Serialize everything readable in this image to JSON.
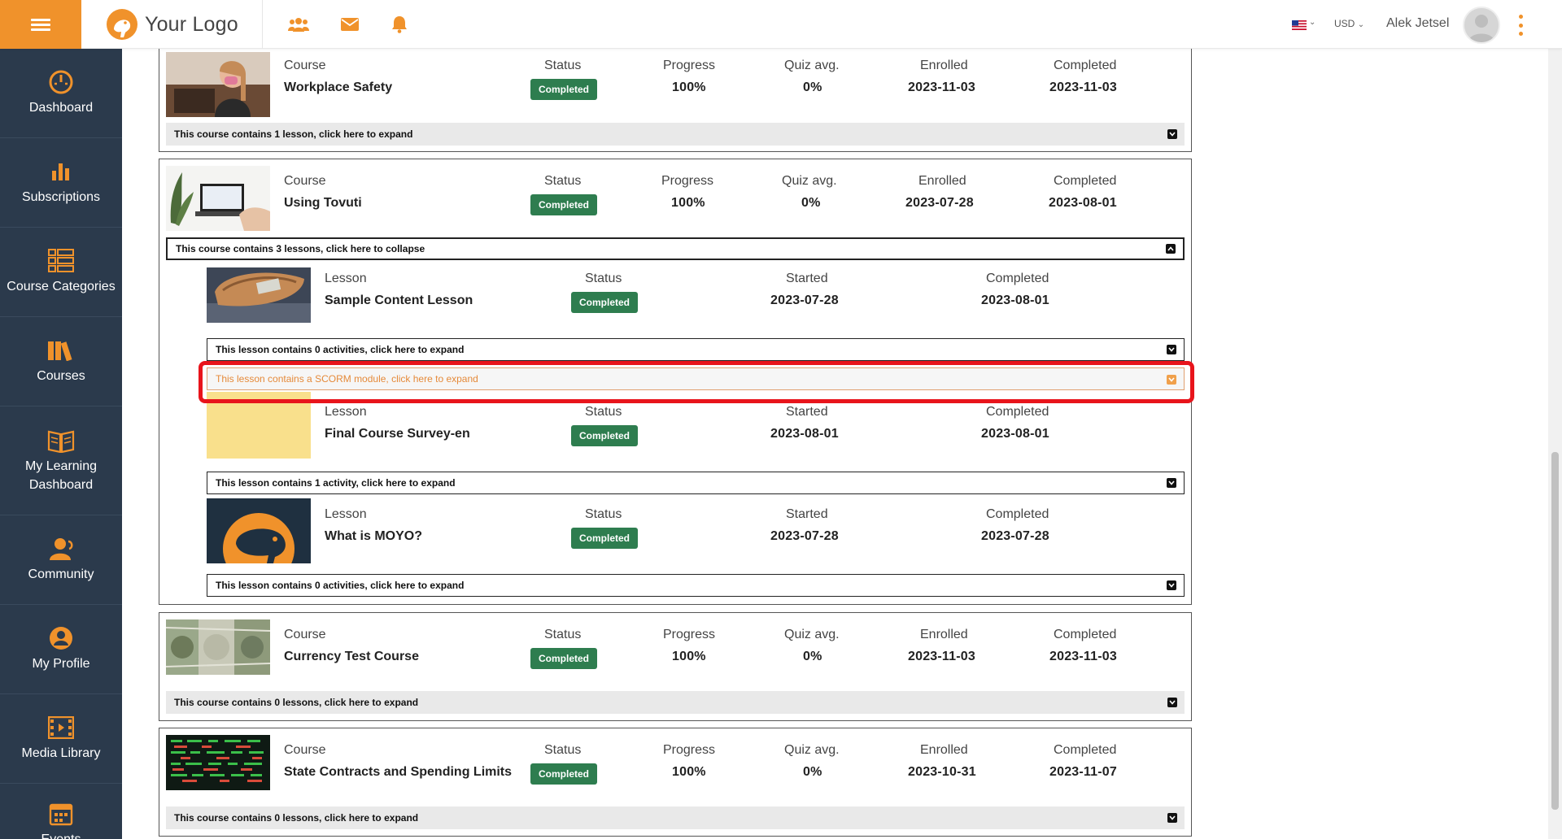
{
  "header": {
    "logo_text": "Your Logo",
    "currency": "USD",
    "user_name": "Alek Jetsel",
    "icons": [
      "users-icon",
      "mail-icon",
      "bell-icon"
    ]
  },
  "sidebar": {
    "items": [
      {
        "label": "Dashboard",
        "icon": "gauge-icon"
      },
      {
        "label": "Subscriptions",
        "icon": "bar-chart-icon"
      },
      {
        "label": "Course Categories",
        "icon": "list-icon"
      },
      {
        "label": "Courses",
        "icon": "books-icon"
      },
      {
        "label": "My Learning Dashboard",
        "icon": "open-book-icon"
      },
      {
        "label": "Community",
        "icon": "community-icon"
      },
      {
        "label": "My Profile",
        "icon": "user-circle-icon"
      },
      {
        "label": "Media Library",
        "icon": "film-icon"
      },
      {
        "label": "Events",
        "icon": "calendar-icon"
      }
    ]
  },
  "labels": {
    "course": "Course",
    "lesson": "Lesson",
    "status": "Status",
    "progress": "Progress",
    "quiz_avg": "Quiz avg.",
    "enrolled": "Enrolled",
    "started": "Started",
    "completed": "Completed"
  },
  "courses": [
    {
      "name": "Workplace Safety",
      "status": "Completed",
      "progress": "100%",
      "quiz_avg": "0%",
      "enrolled": "2023-11-03",
      "completed": "2023-11-03",
      "expand_text": "This course contains 1 lesson, click here to expand"
    },
    {
      "name": "Using Tovuti",
      "status": "Completed",
      "progress": "100%",
      "quiz_avg": "0%",
      "enrolled": "2023-07-28",
      "completed": "2023-08-01",
      "expand_text": "This course contains 3 lessons, click here to collapse",
      "lessons": [
        {
          "name": "Sample Content Lesson",
          "status": "Completed",
          "started": "2023-07-28",
          "completed": "2023-08-01",
          "expand_text": "This lesson contains 0 activities, click here to expand",
          "scorm_text": "This lesson contains a SCORM module, click here to expand"
        },
        {
          "name": "Final Course Survey-en",
          "status": "Completed",
          "started": "2023-08-01",
          "completed": "2023-08-01",
          "expand_text": "This lesson contains 1 activity, click here to expand"
        },
        {
          "name": "What is MOYO?",
          "status": "Completed",
          "started": "2023-07-28",
          "completed": "2023-07-28",
          "expand_text": "This lesson contains 0 activities, click here to expand"
        }
      ]
    },
    {
      "name": "Currency Test Course",
      "status": "Completed",
      "progress": "100%",
      "quiz_avg": "0%",
      "enrolled": "2023-11-03",
      "completed": "2023-11-03",
      "expand_text": "This course contains 0 lessons, click here to expand"
    },
    {
      "name": "State Contracts and Spending Limits",
      "status": "Completed",
      "progress": "100%",
      "quiz_avg": "0%",
      "enrolled": "2023-10-31",
      "completed": "2023-11-07",
      "expand_text": "This course contains 0 lessons, click here to expand"
    }
  ],
  "colors": {
    "accent": "#f0922b",
    "sidebar_bg": "#2b3a4c",
    "badge_green": "#2e7d4f",
    "highlight_red": "#e8141b"
  }
}
